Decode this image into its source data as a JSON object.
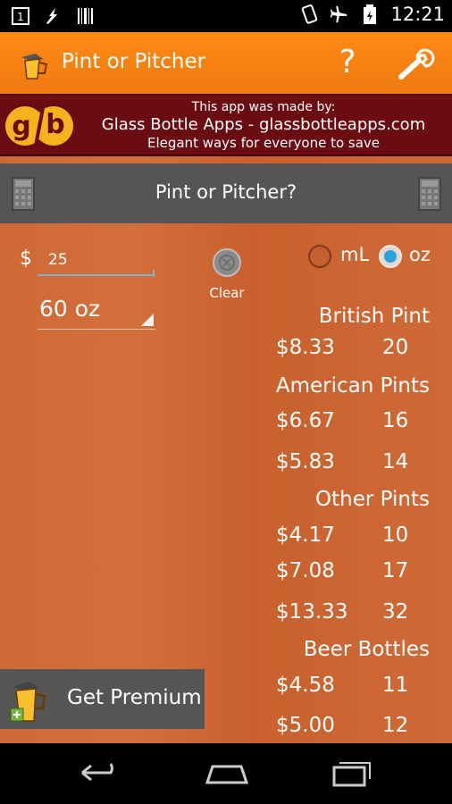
{
  "status_bar": {
    "time": "12:21",
    "notification_badge": "1",
    "icons": [
      "notification-count-icon",
      "flash-icon",
      "barcode-icon",
      "vibrate-icon",
      "airplane-icon",
      "battery-icon"
    ]
  },
  "action_bar": {
    "title": "Pint or Pitcher",
    "help_symbol": "?",
    "icons": [
      "app-logo-icon",
      "help-icon",
      "wrench-icon"
    ]
  },
  "banner": {
    "line1": "This app was made by:",
    "line2": "Glass Bottle Apps - glassbottleapps.com",
    "line3": "Elegant ways for everyone to save",
    "logo_text": "g/b"
  },
  "calculator": {
    "title": "Pint or Pitcher?",
    "currency_symbol": "$",
    "amount_value": "25",
    "size_value": "60 oz",
    "clear_label": "Clear",
    "units": {
      "ml_label": "mL",
      "oz_label": "oz",
      "selected": "oz"
    }
  },
  "results": {
    "sections": [
      {
        "heading": "British Pint",
        "rows": [
          {
            "price": "$8.33",
            "oz": "20"
          }
        ]
      },
      {
        "heading": "American Pints",
        "rows": [
          {
            "price": "$6.67",
            "oz": "16"
          },
          {
            "price": "$5.83",
            "oz": "14"
          }
        ]
      },
      {
        "heading": "Other Pints",
        "rows": [
          {
            "price": "$4.17",
            "oz": "10"
          },
          {
            "price": "$7.08",
            "oz": "17"
          },
          {
            "price": "$13.33",
            "oz": "32"
          }
        ]
      },
      {
        "heading": "Beer Bottles",
        "rows": [
          {
            "price": "$4.58",
            "oz": "11"
          },
          {
            "price": "$5.00",
            "oz": "12"
          }
        ]
      }
    ]
  },
  "premium": {
    "label": "Get Premium"
  },
  "nav_bar": {
    "icons": [
      "back-icon",
      "home-icon",
      "recent-apps-icon"
    ]
  },
  "colors": {
    "action_bar": "#f57f17",
    "banner": "#6b0b12",
    "content": "#cf6a36",
    "panel": "#555555",
    "radio_selected": "#2aa1d8"
  }
}
